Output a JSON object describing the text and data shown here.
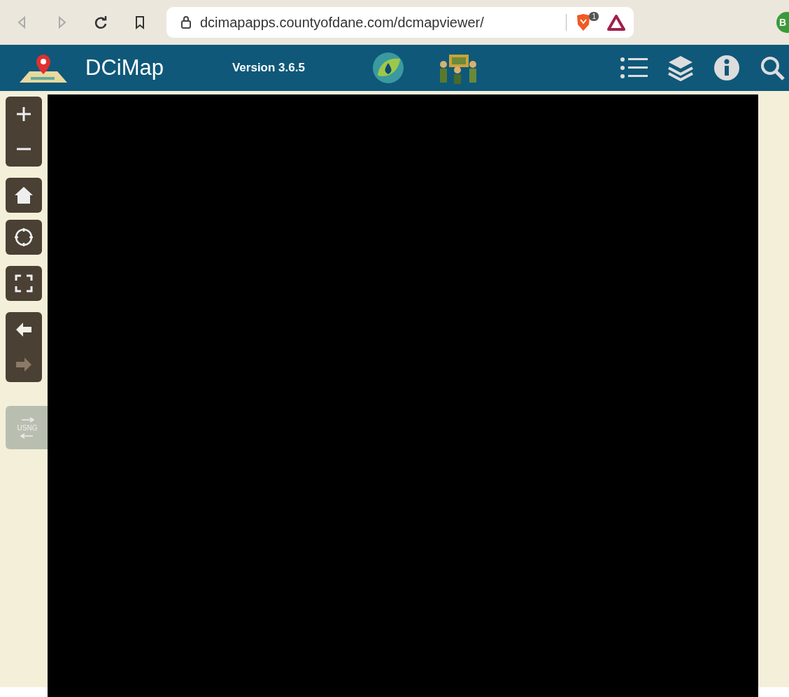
{
  "browser": {
    "url": "dcimapapps.countyofdane.com/dcmapviewer/",
    "shield_badge": "1",
    "profile_initial": "B"
  },
  "app_header": {
    "title": "DCiMap",
    "version": "Version 3.6.5"
  },
  "map_controls": {
    "history": [
      {
        "kind": "back",
        "disabled": false
      },
      {
        "kind": "forward",
        "disabled": true
      }
    ],
    "grid_toggle": "USNG"
  }
}
